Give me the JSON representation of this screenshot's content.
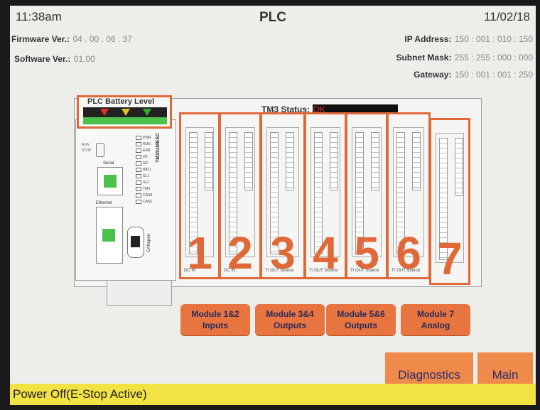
{
  "header": {
    "time": "11:38am",
    "title": "PLC",
    "date": "11/02/18",
    "firmware_label": "Firmware Ver.:",
    "firmware_value": "04 . 00 . 06 . 37",
    "software_label": "Software Ver.:",
    "software_value": "01.00",
    "ip_label": "IP Address:",
    "ip_value": "150 : 001 : 010 : 150",
    "subnet_label": "Subnet Mask:",
    "subnet_value": "255 : 255 : 000 : 000",
    "gateway_label": "Gateway:",
    "gateway_value": "150 : 001 : 001 : 250"
  },
  "battery": {
    "label": "PLC Battery Level",
    "marker_colors": [
      "#e03030",
      "#e8c020",
      "#30b030"
    ]
  },
  "tm3": {
    "label": "TM3 Status:",
    "value": "OK",
    "value_color": "#e03030"
  },
  "controller": {
    "model": "TM251MESC",
    "serial_label": "Serial",
    "ethernet_label": "Ethernet",
    "canopen_label": "CANopen",
    "run_label": "RUN",
    "stop_label": "STOP",
    "led_labels": [
      "PWR",
      "RUN",
      "ERR",
      "I/O",
      "SD",
      "BAT1",
      "SL1",
      "SL2",
      "TM4",
      "CAN0",
      "CAN1"
    ]
  },
  "modules": [
    {
      "number": "1",
      "footer": "DC IN"
    },
    {
      "number": "2",
      "footer": "DC IN"
    },
    {
      "number": "3",
      "footer": "Tr OUT Source"
    },
    {
      "number": "4",
      "footer": "Tr OUT Source"
    },
    {
      "number": "5",
      "footer": "Tr OUT Source"
    },
    {
      "number": "6",
      "footer": "Tr OUT Source"
    },
    {
      "number": "7",
      "footer": ""
    }
  ],
  "buttons": {
    "mod12_line1": "Module 1&2",
    "mod12_line2": "Inputs",
    "mod34_line1": "Module 3&4",
    "mod34_line2": "Outputs",
    "mod56_line1": "Module 5&6",
    "mod56_line2": "Outputs",
    "mod7_line1": "Module 7",
    "mod7_line2": "Analog",
    "diagnostics": "Diagnostics",
    "main": "Main"
  },
  "status_bar": {
    "text": "Power Off(E-Stop Active)"
  },
  "colors": {
    "accent": "#e0693a",
    "button": "#e8743f",
    "status_bar": "#f2e244",
    "led_green": "#4cc24c"
  }
}
